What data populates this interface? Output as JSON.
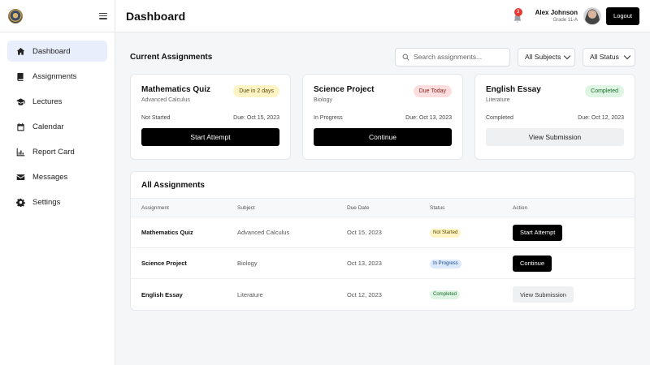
{
  "sidebar": {
    "items": [
      {
        "label": "Dashboard",
        "icon": "home-icon",
        "active": true
      },
      {
        "label": "Assignments",
        "icon": "book-icon"
      },
      {
        "label": "Lectures",
        "icon": "graduation-cap-icon"
      },
      {
        "label": "Calendar",
        "icon": "calendar-icon"
      },
      {
        "label": "Report Card",
        "icon": "bar-chart-icon"
      },
      {
        "label": "Messages",
        "icon": "envelope-icon"
      },
      {
        "label": "Settings",
        "icon": "gear-icon"
      }
    ]
  },
  "header": {
    "title": "Dashboard",
    "notification_count": "3",
    "user_name": "Alex Johnson",
    "user_grade": "Grade 11-A",
    "logout_label": "Logout"
  },
  "current": {
    "title": "Current Assignments",
    "search_placeholder": "Search assignments...",
    "subject_filter": "All Subjects",
    "status_filter": "All Status",
    "cards": [
      {
        "title": "Mathematics Quiz",
        "subject": "Advanced Calculus",
        "badge": "Due in 2 days",
        "status": "Not Started",
        "due": "Due: Oct 15, 2023",
        "action": "Start Attempt"
      },
      {
        "title": "Science Project",
        "subject": "Biology",
        "badge": "Due Today",
        "status": "In Progress",
        "due": "Due: Oct 13, 2023",
        "action": "Continue"
      },
      {
        "title": "English Essay",
        "subject": "Literature",
        "badge": "Completed",
        "status": "Completed",
        "due": "Due: Oct 12, 2023",
        "action": "View Submission"
      }
    ]
  },
  "all": {
    "title": "All Assignments",
    "columns": [
      "Assignment",
      "Subject",
      "Due Date",
      "Status",
      "Action"
    ],
    "rows": [
      {
        "assignment": "Mathematics Quiz",
        "subject": "Advanced Calculus",
        "due": "Oct 15, 2023",
        "status": "Not Started",
        "action": "Start Attempt"
      },
      {
        "assignment": "Science Project",
        "subject": "Biology",
        "due": "Oct 13, 2023",
        "status": "In Progress",
        "action": "Continue"
      },
      {
        "assignment": "English Essay",
        "subject": "Literature",
        "due": "Oct 12, 2023",
        "status": "Completed",
        "action": "View Submission"
      }
    ]
  }
}
